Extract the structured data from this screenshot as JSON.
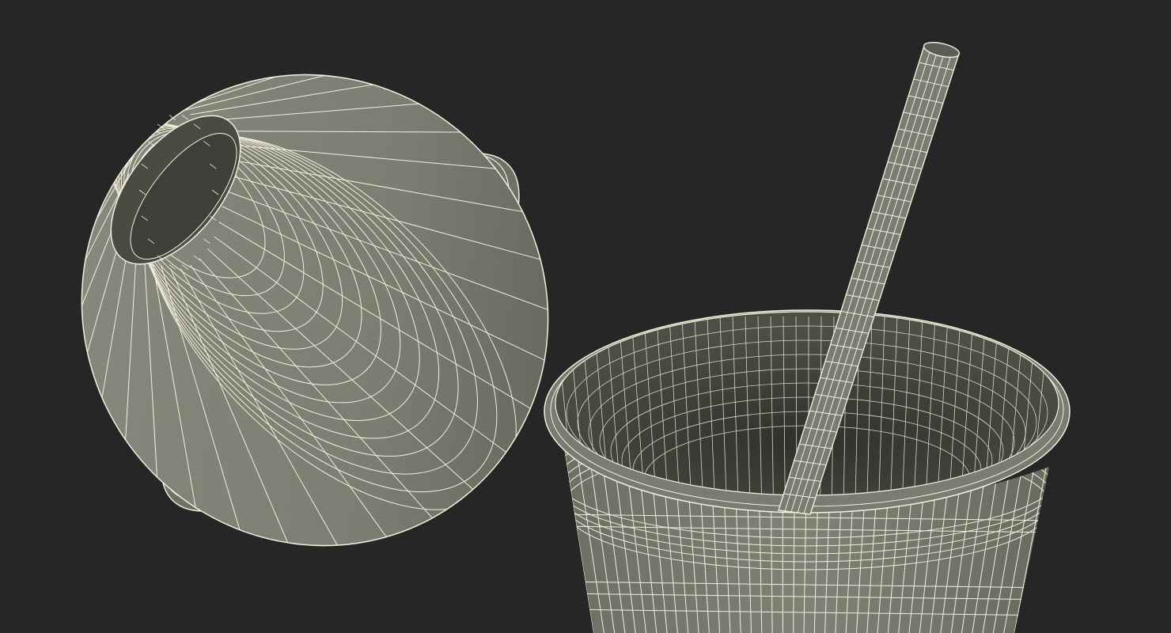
{
  "scene": {
    "background_color": "#262626",
    "surface_color": "#7d7e72",
    "surface_shadow_color": "#5c5d53",
    "inner_color": "#45463e",
    "wire_color": "#f2f0dc",
    "objects": [
      "lid-dome",
      "cup",
      "straw"
    ]
  }
}
